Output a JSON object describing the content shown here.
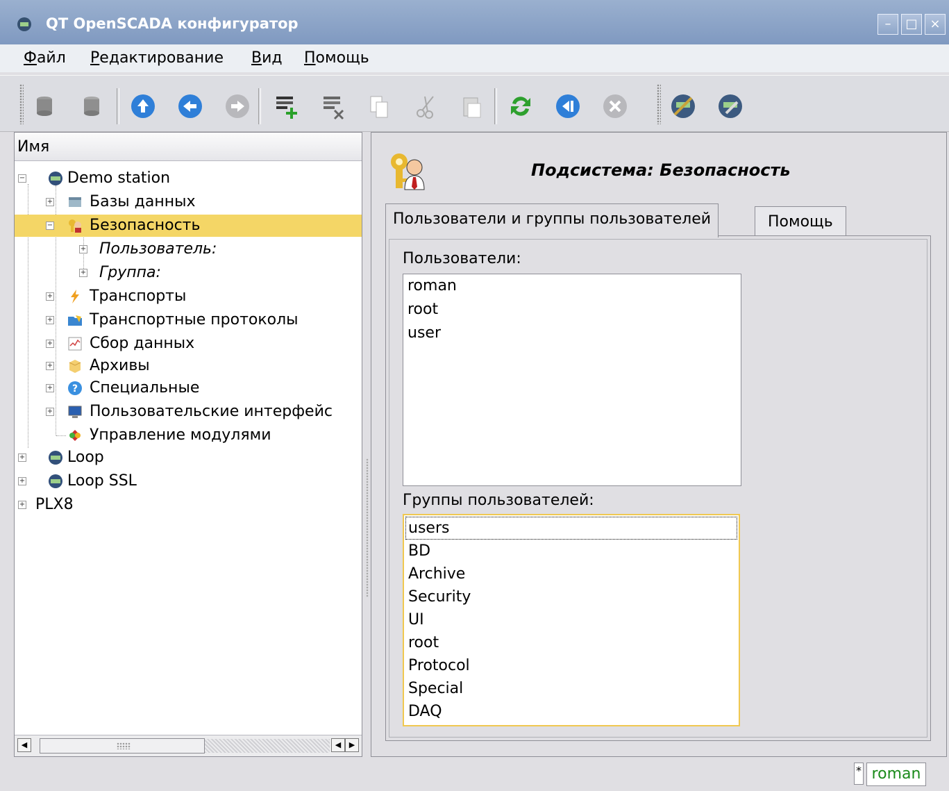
{
  "window": {
    "title": "QT OpenSCADA конфигуратор"
  },
  "menu": {
    "file": "Файл",
    "edit": "Редактирование",
    "view": "Вид",
    "help": "Помощь"
  },
  "tree": {
    "header": "Имя",
    "items": [
      {
        "label": "Demo station"
      },
      {
        "label": "Базы данных"
      },
      {
        "label": "Безопасность"
      },
      {
        "label": "Пользователь:"
      },
      {
        "label": "Группа:"
      },
      {
        "label": "Транспорты"
      },
      {
        "label": "Транспортные протоколы"
      },
      {
        "label": "Сбор данных"
      },
      {
        "label": "Архивы"
      },
      {
        "label": "Специальные"
      },
      {
        "label": "Пользовательские интерфейс"
      },
      {
        "label": "Управление модулями"
      },
      {
        "label": "Loop"
      },
      {
        "label": "Loop SSL"
      },
      {
        "label": "PLX8"
      }
    ]
  },
  "page": {
    "title": "Подсистема: Безопасность",
    "tabs": [
      {
        "label": "Пользователи и группы пользователей"
      },
      {
        "label": "Помощь"
      }
    ],
    "users_label": "Пользователи:",
    "users": [
      "roman",
      "root",
      "user"
    ],
    "groups_label": "Группы пользователей:",
    "groups": [
      "users",
      "BD",
      "Archive",
      "Security",
      "UI",
      "root",
      "Protocol",
      "Special",
      "DAQ"
    ]
  },
  "status": {
    "modified": "*",
    "user": "roman"
  },
  "colors": {
    "selection": "#f4d666",
    "titlebar": "#8aa3c7",
    "user_text": "#1a8a1a"
  }
}
